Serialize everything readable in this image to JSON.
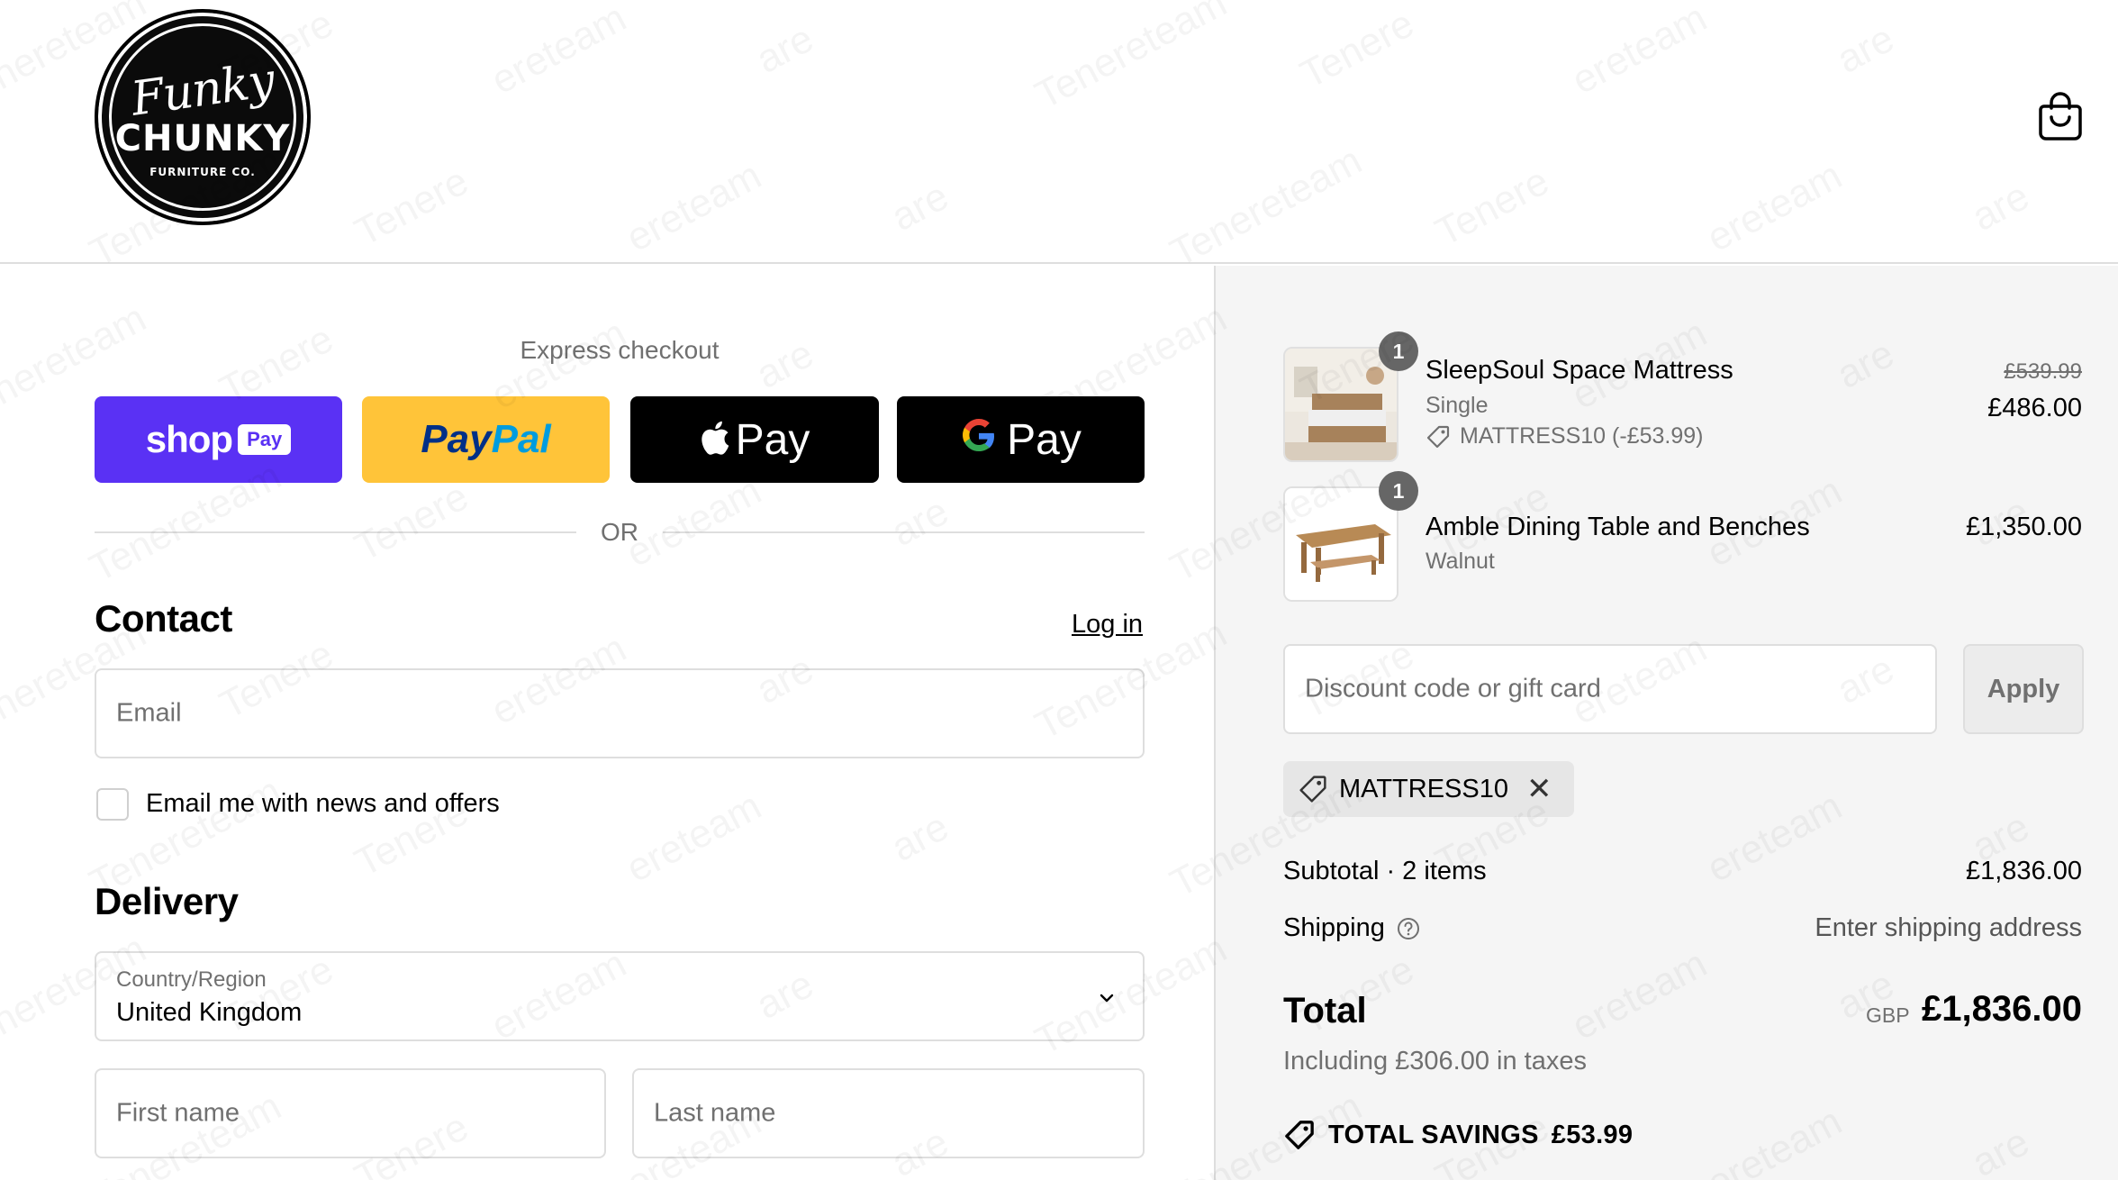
{
  "header": {
    "logo": {
      "script": "Funky",
      "main": "CHUNKY",
      "sub": "FURNITURE CO."
    },
    "cart_icon": "shopping-bag-icon"
  },
  "express": {
    "title": "Express checkout",
    "buttons": [
      {
        "name": "shop-pay",
        "label": "shop",
        "badge": "Pay",
        "color": "#5a31f4"
      },
      {
        "name": "paypal",
        "label_a": "Pay",
        "label_b": "Pal",
        "color": "#ffc439"
      },
      {
        "name": "apple-pay",
        "label": "Pay",
        "color": "#000000"
      },
      {
        "name": "google-pay",
        "g": "G",
        "label": "Pay",
        "color": "#000000"
      }
    ],
    "divider": "OR"
  },
  "contact": {
    "title": "Contact",
    "login": "Log in",
    "email_placeholder": "Email",
    "newsletter_label": "Email me with news and offers",
    "newsletter_checked": false
  },
  "delivery": {
    "title": "Delivery",
    "country_label": "Country/Region",
    "country_value": "United Kingdom",
    "first_name_placeholder": "First name",
    "last_name_placeholder": "Last name"
  },
  "order": {
    "items": [
      {
        "qty": "1",
        "name": "SleepSoul Space Mattress",
        "variant": "Single",
        "discount": "MATTRESS10 (-£53.99)",
        "old_price": "£539.99",
        "price": "£486.00"
      },
      {
        "qty": "1",
        "name": "Amble Dining Table and Benches",
        "variant": "Walnut",
        "price": "£1,350.00"
      }
    ],
    "discount_placeholder": "Discount code or gift card",
    "apply": "Apply",
    "applied_code": "MATTRESS10",
    "subtotal_label": "Subtotal · 2 items",
    "subtotal_value": "£1,836.00",
    "shipping_label": "Shipping",
    "shipping_value": "Enter shipping address",
    "total_label": "Total",
    "currency": "GBP",
    "total_value": "£1,836.00",
    "tax_note": "Including £306.00 in taxes",
    "savings_label": "TOTAL SAVINGS",
    "savings_value": "£53.99"
  },
  "watermark_text": [
    "Tenereteam",
    "Tenere",
    "ereteam",
    "are"
  ]
}
